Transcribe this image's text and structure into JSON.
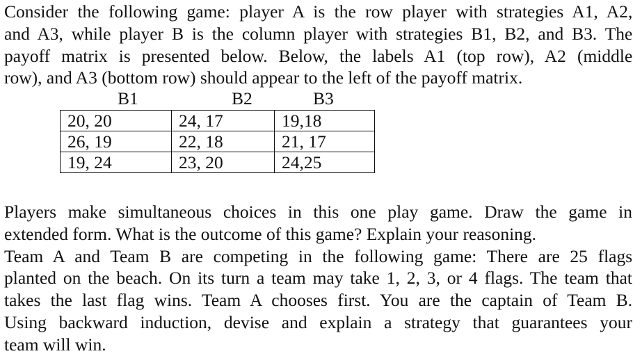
{
  "intro": {
    "lines": [
      "Consider the following game: player A is the row player with strategies A1, A2,",
      "and A3, while player B is the column player with strategies B1, B2, and B3. The",
      "payoff matrix is presented below. Below, the labels A1 (top row), A2 (middle",
      "row), and A3 (bottom row) should appear to the left of the payoff matrix."
    ]
  },
  "payoff_matrix": {
    "column_headers": [
      "B1",
      "B2",
      "B3"
    ],
    "rows": [
      [
        "20, 20",
        "24, 17",
        "19,18"
      ],
      [
        "26, 19",
        "22, 18",
        "21, 17"
      ],
      [
        "19, 24",
        "23, 20",
        "24,25"
      ]
    ]
  },
  "questions": {
    "lines": [
      "Players make simultaneous choices in this one play game. Draw the game in",
      "extended form. What is the outcome of this game? Explain your reasoning.",
      "Team A and Team B are competing in the following game: There are 25 flags",
      "planted on the beach. On its turn a team may take 1, 2, 3, or 4 flags. The team that",
      "takes the last flag wins. Team A chooses first. You are the captain of Team B.",
      "Using backward induction, devise and explain a strategy that guarantees your",
      "team will win."
    ]
  }
}
